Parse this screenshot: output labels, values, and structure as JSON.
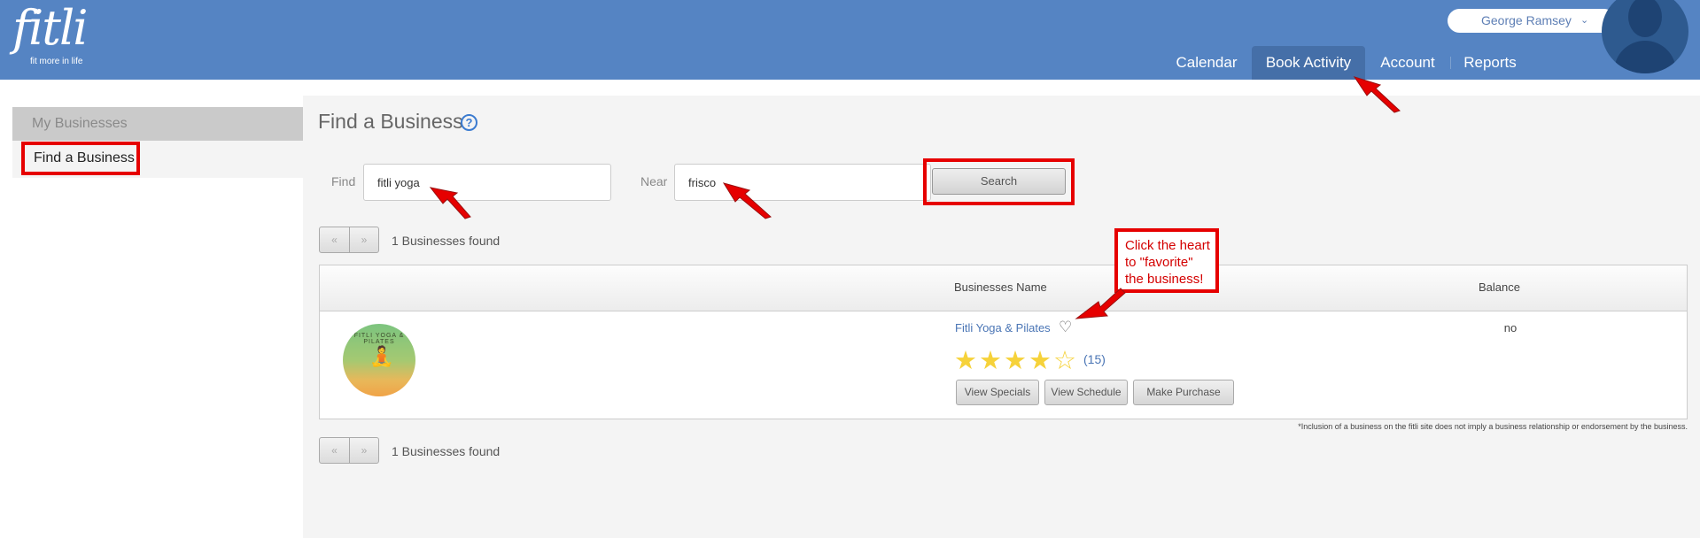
{
  "header": {
    "logo_main": "fitli",
    "logo_tagline": "fit more in life",
    "user_name": "George Ramsey",
    "user_chevron": "⌄",
    "nav": [
      "Calendar",
      "Book Activity",
      "Account",
      "Reports"
    ],
    "active_nav": "Book Activity",
    "brand_color": "#5584c3"
  },
  "sidebar": {
    "items": [
      "My Businesses",
      "Find a Business"
    ]
  },
  "main": {
    "title": "Find a Business",
    "help_icon": "?",
    "find_label": "Find",
    "find_value": "fitli yoga",
    "near_label": "Near",
    "near_value": "frisco",
    "search_label": "Search",
    "pager_prev": "«",
    "pager_next": "»",
    "found_text": "1 Businesses found",
    "table": {
      "headers": [
        "Businesses Name",
        "Balance"
      ],
      "rows": [
        {
          "logo_text": "FITLI YOGA & PILATES",
          "logo_icon": "meditation-figure",
          "name": "Fitli Yoga & Pilates",
          "rating": 4,
          "max_rating": 5,
          "reviews": "(15)",
          "balance": "no",
          "actions": [
            "View Specials",
            "View Schedule",
            "Make Purchase"
          ]
        }
      ]
    },
    "disclaimer": "*Inclusion of a business on the fitli site does not imply a business relationship or endorsement by the business."
  },
  "annotations": {
    "callout_lines": [
      "Click the heart",
      "to \"favorite\"",
      "the business!"
    ],
    "annotation_color": "#e60000"
  }
}
